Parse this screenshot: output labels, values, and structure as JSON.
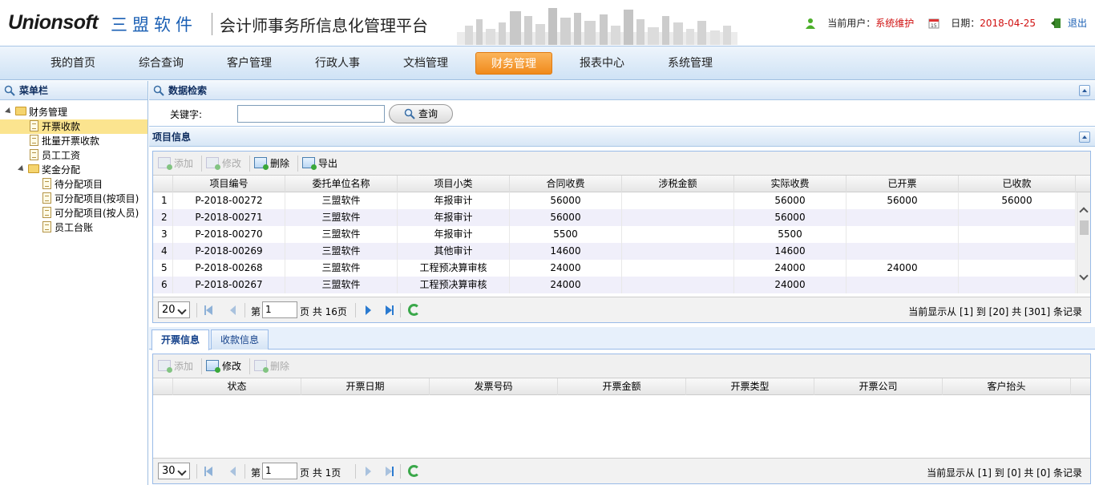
{
  "header": {
    "logo_text": "Unionsoft",
    "logo_cn": "三盟软件",
    "platform_title": "会计师事务所信息化管理平台",
    "current_user_label": "当前用户：",
    "current_user": "系统维护",
    "date_label": "日期：",
    "date": "2018-04-25",
    "logout_label": "退出"
  },
  "nav": {
    "items": [
      "我的首页",
      "综合查询",
      "客户管理",
      "行政人事",
      "文档管理",
      "财务管理",
      "报表中心",
      "系统管理"
    ],
    "active_index": 5
  },
  "sidebar": {
    "title": "菜单栏",
    "tree": [
      {
        "label": "财务管理",
        "level": 0,
        "type": "folder"
      },
      {
        "label": "开票收款",
        "level": 1,
        "type": "doc",
        "selected": true
      },
      {
        "label": "批量开票收款",
        "level": 1,
        "type": "doc"
      },
      {
        "label": "员工工资",
        "level": 1,
        "type": "doc"
      },
      {
        "label": "奖金分配",
        "level": 1,
        "type": "folder"
      },
      {
        "label": "待分配项目",
        "level": 2,
        "type": "doc"
      },
      {
        "label": "可分配项目(按项目)",
        "level": 2,
        "type": "doc"
      },
      {
        "label": "可分配项目(按人员)",
        "level": 2,
        "type": "doc"
      },
      {
        "label": "员工台账",
        "level": 2,
        "type": "doc"
      }
    ]
  },
  "search": {
    "title": "数据检索",
    "keyword_label": "关键字:",
    "keyword_value": "",
    "query_button": "查询"
  },
  "project": {
    "title": "项目信息",
    "toolbar": {
      "add": "添加",
      "edit": "修改",
      "delete": "删除",
      "export": "导出"
    },
    "columns": [
      "项目编号",
      "委托单位名称",
      "项目小类",
      "合同收费",
      "涉税金额",
      "实际收费",
      "已开票",
      "已收款"
    ],
    "rows": [
      [
        "1",
        "P-2018-00272",
        "三盟软件",
        "年报审计",
        "56000",
        "",
        "56000",
        "56000",
        "56000"
      ],
      [
        "2",
        "P-2018-00271",
        "三盟软件",
        "年报审计",
        "56000",
        "",
        "56000",
        "",
        ""
      ],
      [
        "3",
        "P-2018-00270",
        "三盟软件",
        "年报审计",
        "5500",
        "",
        "5500",
        "",
        ""
      ],
      [
        "4",
        "P-2018-00269",
        "三盟软件",
        "其他审计",
        "14600",
        "",
        "14600",
        "",
        ""
      ],
      [
        "5",
        "P-2018-00268",
        "三盟软件",
        "工程预决算审核",
        "24000",
        "",
        "24000",
        "24000",
        ""
      ],
      [
        "6",
        "P-2018-00267",
        "三盟软件",
        "工程预决算审核",
        "24000",
        "",
        "24000",
        "",
        ""
      ]
    ],
    "pager": {
      "page_size": "20",
      "page_prefix": "第",
      "page": "1",
      "page_total": "页 共 16页",
      "info": "当前显示从 [1] 到 [20] 共 [301] 条记录"
    }
  },
  "tabs": {
    "items": [
      "开票信息",
      "收款信息"
    ],
    "active_index": 0
  },
  "invoice": {
    "toolbar": {
      "add": "添加",
      "edit": "修改",
      "delete": "删除"
    },
    "columns": [
      "状态",
      "开票日期",
      "发票号码",
      "开票金额",
      "开票类型",
      "开票公司",
      "客户抬头"
    ],
    "pager": {
      "page_size": "30",
      "page_prefix": "第",
      "page": "1",
      "page_total": "页 共 1页",
      "info": "当前显示从 [1] 到 [0] 共 [0] 条记录"
    }
  },
  "colors": {
    "accent_orange": "#f08a1c",
    "nav_blue": "#cfe2f5",
    "user_red": "#d01010",
    "link_blue": "#1a5fb4"
  }
}
